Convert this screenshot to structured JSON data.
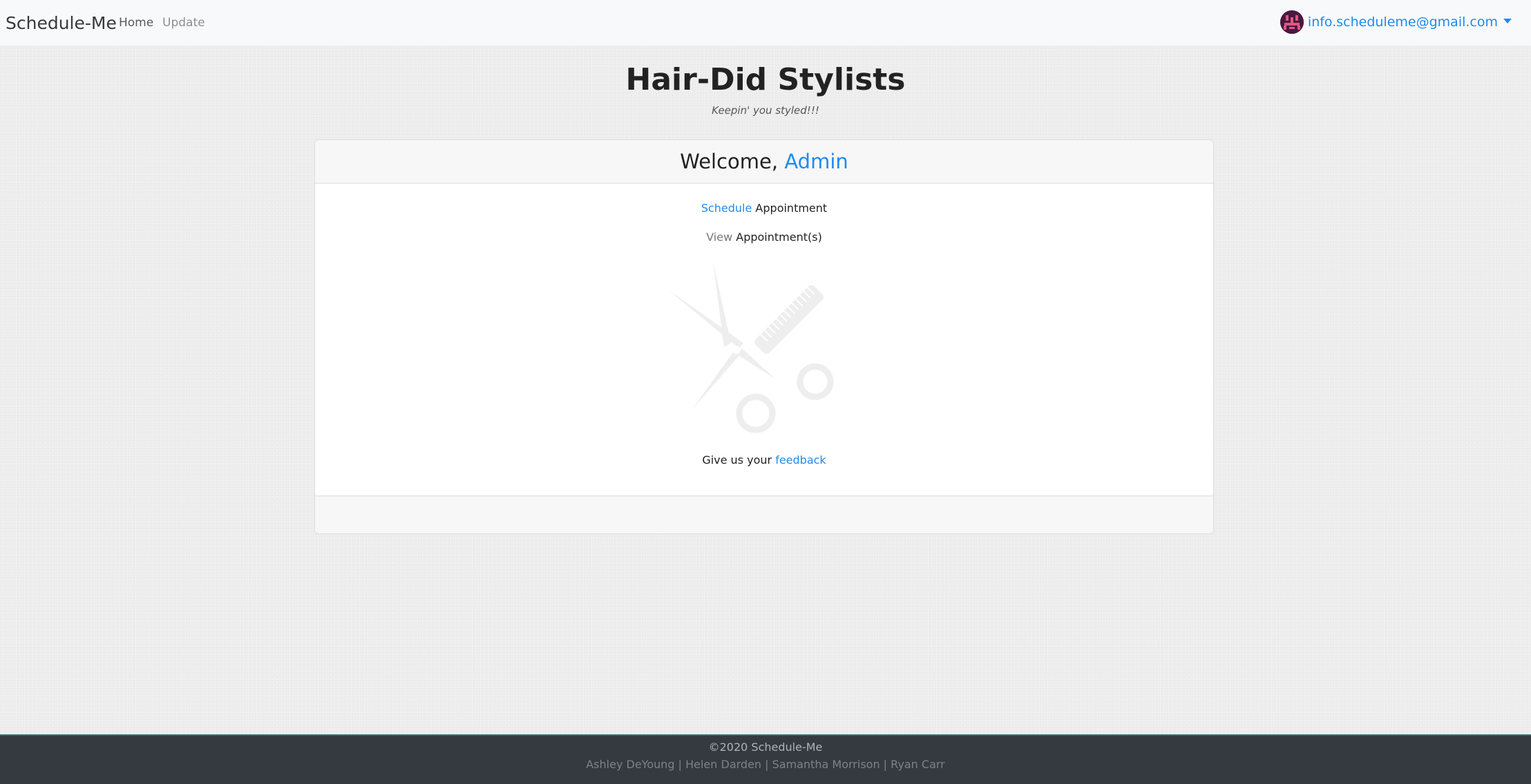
{
  "navbar": {
    "brand": "Schedule-Me",
    "links": [
      {
        "label": "Home"
      },
      {
        "label": "Update"
      }
    ],
    "user_email": "info.scheduleme@gmail.com"
  },
  "header": {
    "title": "Hair-Did Stylists",
    "tagline": "Keepin' you styled!!!"
  },
  "card": {
    "welcome_prefix": "Welcome, ",
    "welcome_name": "Admin",
    "schedule_link": "Schedule",
    "schedule_text": " Appointment",
    "view_link": "View",
    "view_text": " Appointment(s)",
    "feedback_prefix": "Give us your ",
    "feedback_link": "feedback",
    "illustration_icon": "scissors-comb-icon"
  },
  "footer": {
    "copyright": "©2020 Schedule-Me",
    "authors": "Ashley DeYoung | Helen Darden | Samantha Morrison | Ryan Carr"
  },
  "colors": {
    "accent": "#1e8bf0",
    "footer_bg": "#343a40",
    "navbar_bg": "#f8f9fa"
  }
}
